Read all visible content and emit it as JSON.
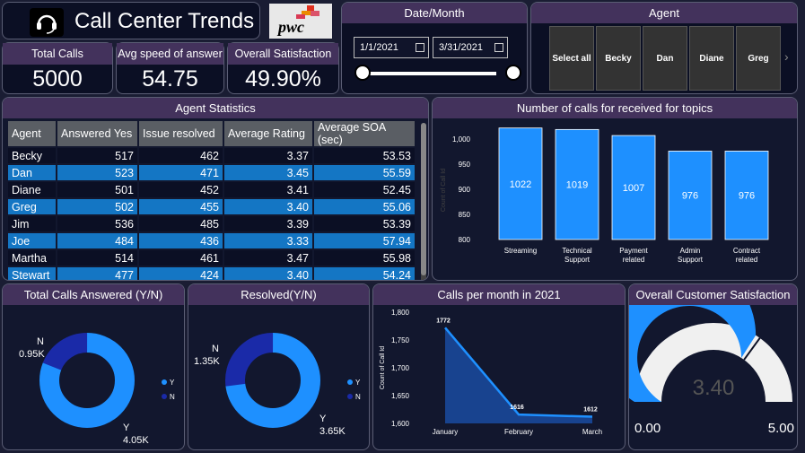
{
  "header": {
    "title": "Call Center Trends",
    "brand": "pwc"
  },
  "kpis": {
    "total_calls_label": "Total Calls",
    "total_calls": "5000",
    "avg_speed_label": "Avg speed of answer",
    "avg_speed": "54.75",
    "satisfaction_label": "Overall Satisfaction",
    "satisfaction": "49.90%"
  },
  "date_slicer": {
    "title": "Date/Month",
    "start": "1/1/2021",
    "end": "3/31/2021"
  },
  "agent_slicer": {
    "title": "Agent",
    "buttons": [
      "Select all",
      "Becky",
      "Dan",
      "Diane",
      "Greg"
    ]
  },
  "agent_table": {
    "title": "Agent Statistics",
    "columns": [
      "Agent",
      "Answered Yes",
      "Issue resolved",
      "Average Rating",
      "Average SOA (sec)"
    ],
    "rows": [
      [
        "Becky",
        "517",
        "462",
        "3.37",
        "53.53"
      ],
      [
        "Dan",
        "523",
        "471",
        "3.45",
        "55.59"
      ],
      [
        "Diane",
        "501",
        "452",
        "3.41",
        "52.45"
      ],
      [
        "Greg",
        "502",
        "455",
        "3.40",
        "55.06"
      ],
      [
        "Jim",
        "536",
        "485",
        "3.39",
        "53.39"
      ],
      [
        "Joe",
        "484",
        "436",
        "3.33",
        "57.94"
      ],
      [
        "Martha",
        "514",
        "461",
        "3.47",
        "55.98"
      ],
      [
        "Stewart",
        "477",
        "424",
        "3.40",
        "54.24"
      ]
    ]
  },
  "colors": {
    "accent": "#1e90ff",
    "dark_blue": "#1a2aa8",
    "header": "#43325c"
  },
  "chart_data": [
    {
      "type": "bar",
      "title": "Number of calls for received for topics",
      "ylabel": "Count of Call Id",
      "categories": [
        "Streaming",
        "Technical Support",
        "Payment related",
        "Admin Support",
        "Contract related"
      ],
      "values": [
        1022,
        1019,
        1007,
        976,
        976
      ],
      "ylim": [
        800,
        1000
      ],
      "yticks": [
        "800",
        "850",
        "900",
        "950",
        "1,000"
      ]
    },
    {
      "type": "pie",
      "title": "Total Calls Answered (Y/N)",
      "categories": [
        "Y",
        "N"
      ],
      "values": [
        4050,
        950
      ],
      "value_labels": [
        "4.05K",
        "0.95K"
      ],
      "legend": [
        "Y",
        "N"
      ]
    },
    {
      "type": "pie",
      "title": "Resolved(Y/N)",
      "categories": [
        "Y",
        "N"
      ],
      "values": [
        3650,
        1350
      ],
      "value_labels": [
        "3.65K",
        "1.35K"
      ],
      "legend": [
        "Y",
        "N"
      ]
    },
    {
      "type": "area",
      "title": "Calls per month in 2021",
      "ylabel": "Count of Call Id",
      "categories": [
        "January",
        "February",
        "March"
      ],
      "values": [
        1772,
        1616,
        1612
      ],
      "ylim": [
        1600,
        1800
      ],
      "yticks": [
        "1,600",
        "1,650",
        "1,700",
        "1,750",
        "1,800"
      ]
    },
    {
      "type": "gauge",
      "title": "Overall Customer Satisfaction",
      "value": 3.4,
      "value_label": "3.40",
      "min": 0,
      "max": 5,
      "target": 3.4,
      "min_label": "0.00",
      "max_label": "5.00"
    }
  ]
}
